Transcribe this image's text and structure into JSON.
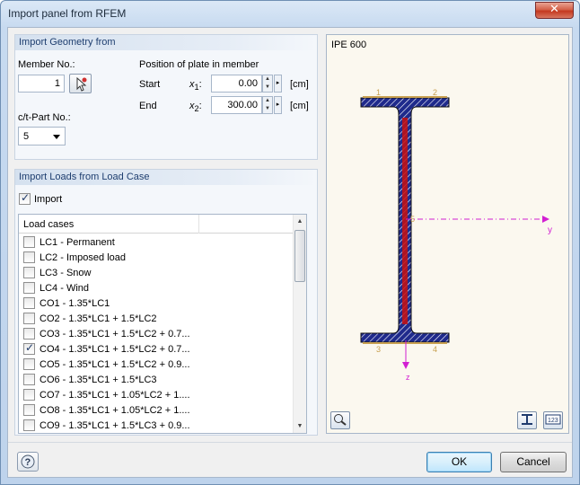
{
  "window": {
    "title": "Import panel from RFEM",
    "close_glyph": "✕"
  },
  "geometry": {
    "section_title": "Import Geometry from",
    "member_label": "Member No.:",
    "member_value": "1",
    "ct_part_label": "c/t-Part No.:",
    "ct_part_value": "5",
    "position_label": "Position of plate in member",
    "start_label": "Start",
    "start_var": "x",
    "start_sub": "1",
    "start_value": "0.00",
    "start_unit": "[cm]",
    "end_label": "End",
    "end_var": "x",
    "end_sub": "2",
    "end_value": "300.00",
    "end_unit": "[cm]",
    "pick_icon": "pick-member-icon"
  },
  "loads": {
    "section_title": "Import Loads from Load Case",
    "import_label": "Import",
    "import_checked": true,
    "column_header": "Load cases",
    "rows": [
      {
        "label": "LC1 - Permanent",
        "checked": false
      },
      {
        "label": "LC2 - Imposed load",
        "checked": false
      },
      {
        "label": "LC3 - Snow",
        "checked": false
      },
      {
        "label": "LC4 - Wind",
        "checked": false
      },
      {
        "label": "CO1 - 1.35*LC1",
        "checked": false
      },
      {
        "label": "CO2 - 1.35*LC1 + 1.5*LC2",
        "checked": false
      },
      {
        "label": "CO3 - 1.35*LC1 + 1.5*LC2 + 0.7...",
        "checked": false
      },
      {
        "label": "CO4 - 1.35*LC1 + 1.5*LC2 + 0.7...",
        "checked": true
      },
      {
        "label": "CO5 - 1.35*LC1 + 1.5*LC2 + 0.9...",
        "checked": false
      },
      {
        "label": "CO6 - 1.35*LC1 + 1.5*LC3",
        "checked": false
      },
      {
        "label": "CO7 - 1.35*LC1 + 1.05*LC2 + 1....",
        "checked": false
      },
      {
        "label": "CO8 - 1.35*LC1 + 1.05*LC2 + 1....",
        "checked": false
      },
      {
        "label": "CO9 - 1.35*LC1 + 1.5*LC3 + 0.9...",
        "checked": false
      }
    ]
  },
  "preview": {
    "section_name": "IPE 600",
    "points": {
      "p1": "1",
      "p2": "2",
      "p3": "3",
      "p4": "4",
      "p5": "5"
    },
    "axis_y": "y",
    "axis_z": "z",
    "colors": {
      "steel_fill": "#1f2a8c",
      "hatch": "#ffffff",
      "highlight": "#c81010",
      "axis": "#d21fd2",
      "edge": "#c8a050"
    }
  },
  "footer": {
    "help_icon": "help-icon",
    "ok_label": "OK",
    "cancel_label": "Cancel"
  }
}
